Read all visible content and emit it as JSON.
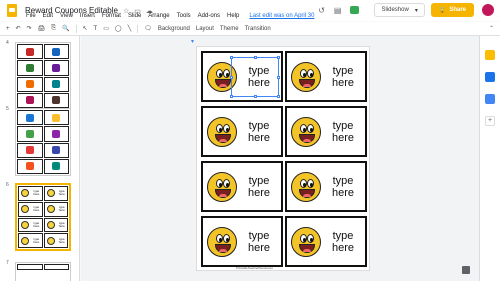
{
  "window": {
    "title": "Reward Coupons Editable",
    "last_edit": "Last edit was on April 30"
  },
  "menu": [
    "File",
    "Edit",
    "View",
    "Insert",
    "Format",
    "Slide",
    "Arrange",
    "Tools",
    "Add-ons",
    "Help"
  ],
  "toolbar": {
    "buttons": [
      "+",
      "↶",
      "↷",
      "🖨",
      "⎘",
      "🔍",
      "↖",
      "T",
      "▭",
      "◯",
      "╲",
      "🗨",
      "⬚"
    ],
    "bg_label": "Background",
    "layout_label": "Layout",
    "theme_label": "Theme",
    "transition_label": "Transition"
  },
  "actions": {
    "slideshow_label": "Slideshow",
    "share_label": "Share"
  },
  "slides": {
    "numbers": [
      "4",
      "5",
      "6",
      "7"
    ]
  },
  "thumb_texts": [
    "type",
    "here"
  ],
  "coupon": {
    "line1": "type",
    "line2": "here"
  },
  "slide_footer": "PrintableTeacherResources",
  "colors": {
    "accent": "#f4b400",
    "selection": "#4285f4"
  }
}
